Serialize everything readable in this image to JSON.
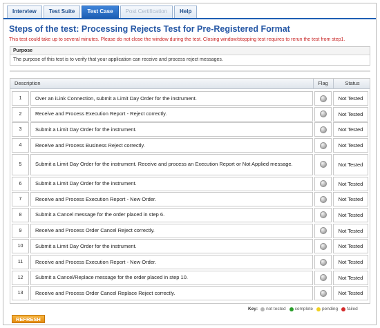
{
  "tabs": [
    {
      "label": "Interview",
      "state": "normal"
    },
    {
      "label": "Test Suite",
      "state": "normal"
    },
    {
      "label": "Test Case",
      "state": "active"
    },
    {
      "label": "Post Certification",
      "state": "disabled"
    },
    {
      "label": "Help",
      "state": "normal"
    }
  ],
  "page": {
    "title": "Steps of the test: Processing Rejects Test for Pre-Registered Format",
    "warning": "This test could take up to several minutes. Please do not close the window during the test. Closing window/stopping test requires to rerun the test from step1."
  },
  "purpose": {
    "heading": "Purpose",
    "text": "The purpose of this test is to verify that your application can receive and process reject messages."
  },
  "table": {
    "headers": {
      "description": "Description",
      "flag": "Flag",
      "status": "Status"
    },
    "rows": [
      {
        "num": "1",
        "desc": "Over an iLink Connection, submit a Limit Day Order for the instrument.",
        "status": "Not Tested"
      },
      {
        "num": "2",
        "desc": "Receive and Process Execution Report - Reject correctly.",
        "status": "Not Tested"
      },
      {
        "num": "3",
        "desc": "Submit a Limit Day Order for the instrument.",
        "status": "Not Tested"
      },
      {
        "num": "4",
        "desc": "Receive and Process Business Reject correctly.",
        "status": "Not Tested"
      },
      {
        "num": "5",
        "desc": "Submit a Limit Day Order for the instrument. Receive and process an Execution Report or Not Applied message.",
        "status": "Not Tested"
      },
      {
        "num": "6",
        "desc": "Submit a Limit Day Order for the instrument.",
        "status": "Not Tested"
      },
      {
        "num": "7",
        "desc": "Receive and Process Execution Report - New Order.",
        "status": "Not Tested"
      },
      {
        "num": "8",
        "desc": "Submit a Cancel message for the order placed in step 6.",
        "status": "Not Tested"
      },
      {
        "num": "9",
        "desc": "Receive and Process Order Cancel Reject correctly.",
        "status": "Not Tested"
      },
      {
        "num": "10",
        "desc": "Submit a Limit Day Order for the instrument.",
        "status": "Not Tested"
      },
      {
        "num": "11",
        "desc": "Receive and Process Execution Report - New Order.",
        "status": "Not Tested"
      },
      {
        "num": "12",
        "desc": "Submit a Cancel/Replace message for the order placed in step 10.",
        "status": "Not Tested"
      },
      {
        "num": "13",
        "desc": "Receive and Process Order Cancel Replace Reject correctly.",
        "status": "Not Tested"
      }
    ],
    "flag_icon": "gray-status-dot-icon"
  },
  "key": {
    "label": "Key:",
    "items": [
      {
        "label": "not tested",
        "color": "#b5b5b5"
      },
      {
        "label": "complete",
        "color": "#2a9d2a"
      },
      {
        "label": "pending",
        "color": "#f0d020"
      },
      {
        "label": "failed",
        "color": "#d42a2a"
      }
    ]
  },
  "buttons": {
    "refresh": "REFRESH"
  },
  "colors": {
    "accent": "#1d5fb4",
    "title": "#2456a4",
    "warning": "#c62020",
    "refresh": "#e58b10"
  }
}
